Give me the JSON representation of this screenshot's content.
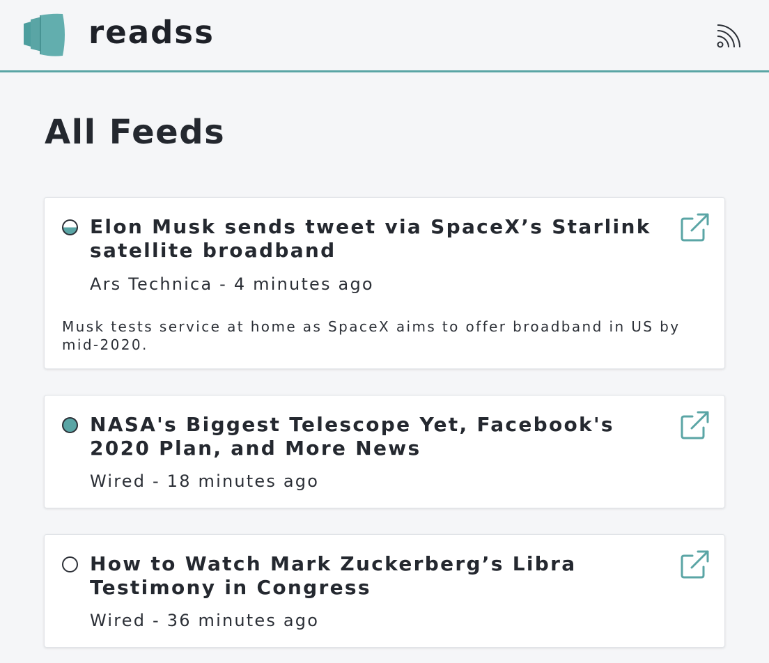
{
  "app": {
    "title": "readss",
    "accent_color": "#5aa5a5",
    "logo_icon": "stacked-pages-logo",
    "rss_icon": "rss-icon"
  },
  "page": {
    "title": "All Feeds"
  },
  "feed_items": [
    {
      "title": "Elon Musk sends tweet via SpaceX’s Starlink satellite broadband",
      "source": "Ars Technica",
      "separator": "-",
      "age": "4 minutes ago",
      "meta": "Ars Technica - 4 minutes ago",
      "description": "Musk tests service at home as SpaceX aims to offer broadband in US by mid-2020.",
      "read_status": "half",
      "link_icon": "external-link-icon"
    },
    {
      "title": "NASA's Biggest Telescope Yet, Facebook's 2020 Plan, and More News",
      "source": "Wired",
      "separator": "-",
      "age": "18 minutes ago",
      "meta": "Wired - 18 minutes ago",
      "description": "",
      "read_status": "full",
      "link_icon": "external-link-icon"
    },
    {
      "title": "How to Watch Mark Zuckerberg’s Libra Testimony in Congress",
      "source": "Wired",
      "separator": "-",
      "age": "36 minutes ago",
      "meta": "Wired - 36 minutes ago",
      "description": "",
      "read_status": "empty",
      "link_icon": "external-link-icon"
    }
  ]
}
